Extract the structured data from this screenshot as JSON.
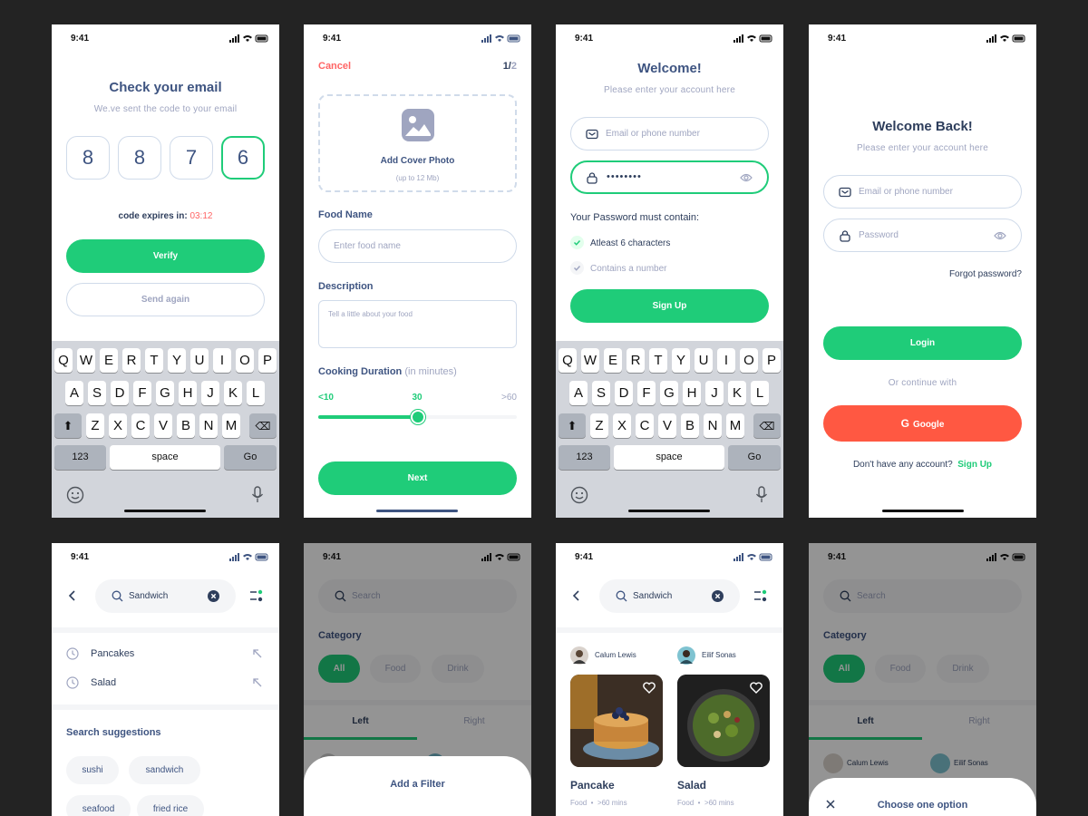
{
  "status": {
    "time": "9:41"
  },
  "colors": {
    "primary": "#1fcc79",
    "danger": "#ff6464",
    "text": "#3e5481",
    "muted": "#9fa5c0",
    "google": "#ff5842"
  },
  "verify": {
    "title": "Check your email",
    "subtitle": "We.ve sent the code to your email",
    "code": [
      "8",
      "8",
      "7",
      "6"
    ],
    "expires_label": "code expires in:",
    "expires_time": "03:12",
    "verify_btn": "Verify",
    "send_again_btn": "Send again"
  },
  "keyboard": {
    "row1": [
      "Q",
      "W",
      "E",
      "R",
      "T",
      "Y",
      "U",
      "I",
      "O",
      "P"
    ],
    "row2": [
      "A",
      "S",
      "D",
      "F",
      "G",
      "H",
      "J",
      "K",
      "L"
    ],
    "row3": [
      "Z",
      "X",
      "C",
      "V",
      "B",
      "N",
      "M"
    ],
    "num": "123",
    "space": "space",
    "go": "Go"
  },
  "upload": {
    "cancel": "Cancel",
    "step_current": "1/",
    "step_total": "2",
    "cover_title": "Add Cover Photo",
    "cover_hint": "(up to 12 Mb)",
    "food_name_label": "Food Name",
    "food_name_placeholder": "Enter food name",
    "desc_label": "Description",
    "desc_placeholder": "Tell a little about your food",
    "duration_label": "Cooking Duration",
    "duration_unit": "(in minutes)",
    "slider_min": "<10",
    "slider_value": "30",
    "slider_max": ">60",
    "slider_fraction": 0.5,
    "next_btn": "Next"
  },
  "signup": {
    "title": "Welcome!",
    "subtitle": "Please enter your account here",
    "email_placeholder": "Email or phone number",
    "password_value": "••••••••",
    "rules_title": "Your Password must contain:",
    "rule1": "Atleast 6 characters",
    "rule2": "Contains a number",
    "signup_btn": "Sign Up"
  },
  "login": {
    "title": "Welcome Back!",
    "subtitle": "Please enter your account here",
    "email_placeholder": "Email or phone number",
    "password_placeholder": "Password",
    "forgot": "Forgot password?",
    "login_btn": "Login",
    "or_continue": "Or continue with",
    "google_btn": "Google",
    "no_account": "Don't have any account?",
    "signup_link": "Sign Up"
  },
  "search": {
    "query": "Sandwich",
    "history": [
      "Pancakes",
      "Salad"
    ],
    "suggestions_title": "Search suggestions",
    "suggestions": [
      "sushi",
      "sandwich",
      "seafood",
      "fried rice"
    ]
  },
  "filter": {
    "search_placeholder": "Search",
    "category_label": "Category",
    "categories": [
      "All",
      "Food",
      "Drink"
    ],
    "tabs": [
      "Left",
      "Right"
    ],
    "sheet_title": "Add a Filter"
  },
  "results": {
    "query": "Sandwich",
    "items": [
      {
        "author": "Calum Lewis",
        "title": "Pancake",
        "meta": "Food",
        "time": ">60 mins"
      },
      {
        "author": "Eilif Sonas",
        "title": "Salad",
        "meta": "Food",
        "time": ">60 mins"
      }
    ]
  },
  "option": {
    "search_placeholder": "Search",
    "category_label": "Category",
    "categories": [
      "All",
      "Food",
      "Drink"
    ],
    "tabs": [
      "Left",
      "Right"
    ],
    "authors": [
      "Calum Lewis",
      "Eilif Sonas"
    ],
    "sheet_title": "Choose one option"
  }
}
